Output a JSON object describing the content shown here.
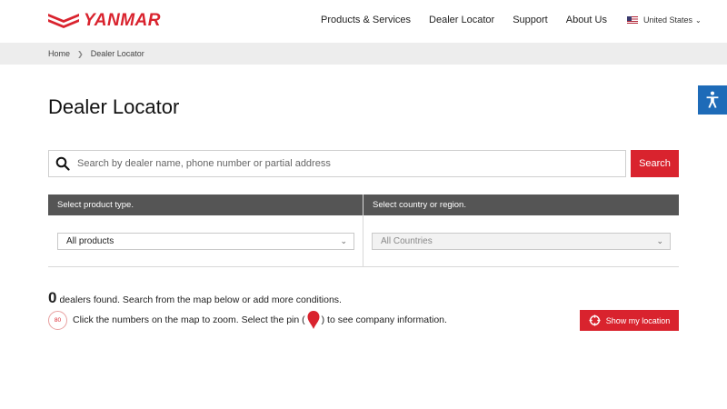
{
  "header": {
    "logo_text": "YANMAR",
    "nav": [
      "Products & Services",
      "Dealer Locator",
      "Support",
      "About Us"
    ],
    "region": "United States"
  },
  "breadcrumb": {
    "home": "Home",
    "current": "Dealer Locator"
  },
  "page": {
    "title": "Dealer Locator"
  },
  "search": {
    "placeholder": "Search by dealer name, phone number or partial address",
    "value": "",
    "button_label": "Search"
  },
  "filters": {
    "product_header": "Select product type.",
    "product_selected": "All products",
    "country_header": "Select country or region.",
    "country_selected": "All Countries"
  },
  "results": {
    "count": "0",
    "found_text": "dealers found. Search from the map below or add more conditions.",
    "cluster_example": "80",
    "hint_before": "Click the numbers on the map to zoom. Select the pin (",
    "hint_after": ") to see company information.",
    "locate_label": "Show my location"
  },
  "colors": {
    "brand_red": "#d9232e",
    "filter_header": "#555555",
    "accessibility_blue": "#1e6bb8"
  }
}
